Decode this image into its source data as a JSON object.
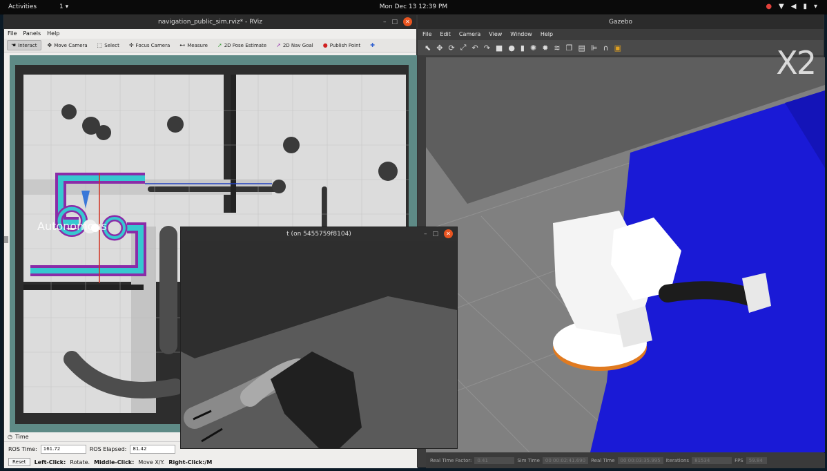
{
  "topbar": {
    "activities": "Activities",
    "workspace": "1 ▾",
    "clock": "Mon Dec 13  12:39 PM",
    "tray_icons": [
      "record-icon",
      "wifi-icon",
      "volume-icon",
      "battery-icon",
      "power-menu-icon"
    ]
  },
  "rviz": {
    "title": "navigation_public_sim.rviz* - RViz",
    "menu": [
      "File",
      "Panels",
      "Help"
    ],
    "tools": [
      {
        "label": "Interact",
        "icon": "interact-icon",
        "active": true
      },
      {
        "label": "Move Camera",
        "icon": "move-camera-icon"
      },
      {
        "label": "Select",
        "icon": "select-icon"
      },
      {
        "label": "Focus Camera",
        "icon": "focus-camera-icon"
      },
      {
        "label": "Measure",
        "icon": "measure-icon"
      },
      {
        "label": "2D Pose Estimate",
        "icon": "pose-estimate-icon"
      },
      {
        "label": "2D Nav Goal",
        "icon": "nav-goal-icon"
      },
      {
        "label": "Publish Point",
        "icon": "publish-point-icon"
      }
    ],
    "map_overlay_text": "Autonomous",
    "time_panel": {
      "header": "Time",
      "ros_time_label": "ROS Time:",
      "ros_time_value": "161.72",
      "ros_elapsed_label": "ROS Elapsed:",
      "ros_elapsed_value": "81.42",
      "reset_label": "Reset",
      "hint_left": "Left-Click:",
      "hint_left_action": "Rotate.",
      "hint_middle": "Middle-Click:",
      "hint_middle_action": "Move X/Y.",
      "hint_right": "Right-Click:/M"
    }
  },
  "gazebo": {
    "title": "Gazebo",
    "menu": [
      "File",
      "Edit",
      "Camera",
      "View",
      "Window",
      "Help"
    ],
    "logo": "X2",
    "status": {
      "real_time_factor_label": "Real Time Factor:",
      "real_time_factor_value": "0.41",
      "sim_time_label": "Sim Time",
      "sim_time_value": "00 00:02:41.690",
      "real_time_label": "Real Time",
      "real_time_value": "00 00:03:35.995",
      "iterations_label": "Iterations",
      "iterations_value": "81534",
      "fps_label": "FPS",
      "fps_value": "59.84"
    }
  },
  "camera_window": {
    "title": "t (on 5455759f8104)"
  }
}
